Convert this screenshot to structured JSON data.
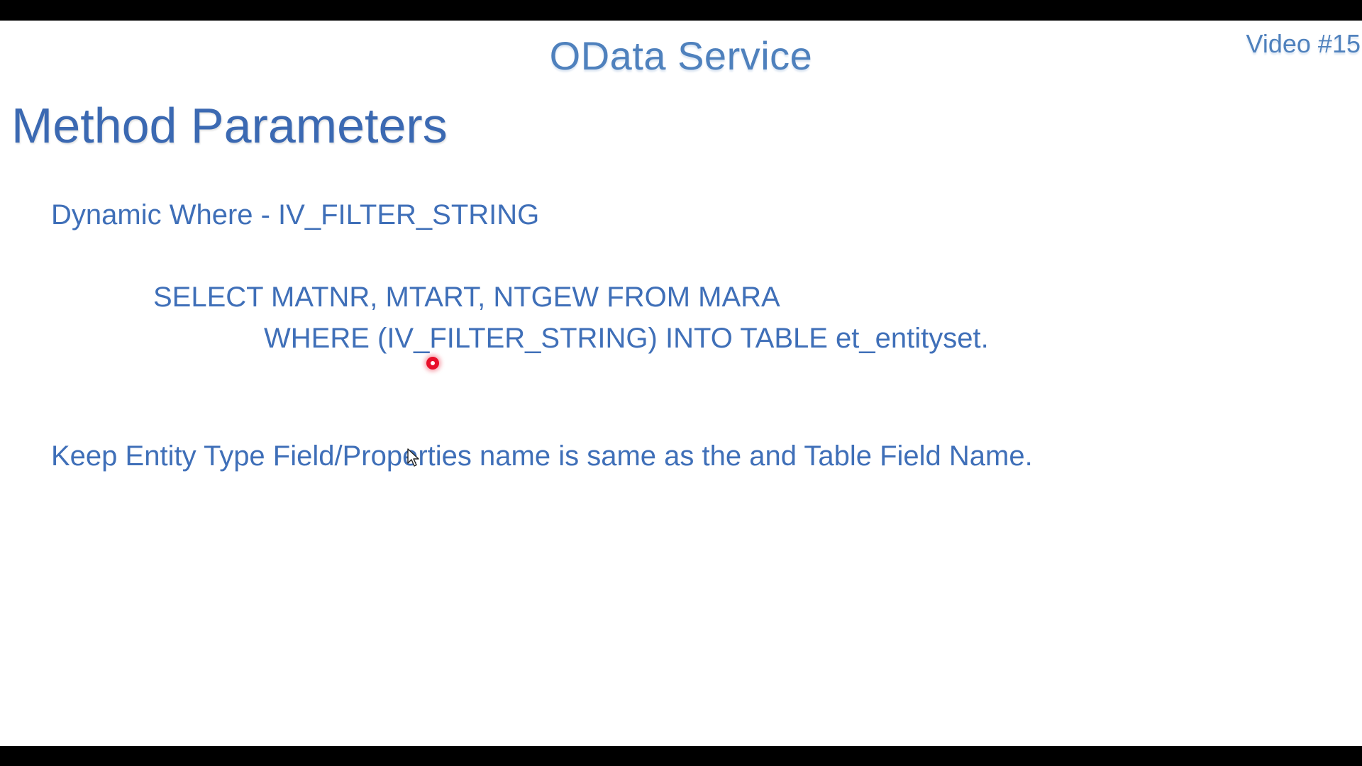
{
  "slide": {
    "header_title": "OData Service",
    "video_label": "Video #15",
    "title": "Method Parameters",
    "lines": [
      "Dynamic Where - IV_FILTER_STRING",
      "SELECT MATNR, MTART, NTGEW FROM MARA",
      "WHERE (IV_FILTER_STRING) INTO TABLE et_entityset.",
      "Keep Entity Type Field/Properties name is same as the and Table Field Name."
    ]
  },
  "colors": {
    "accent": "#4f81bd",
    "title": "#3b69b2",
    "body_text": "#3f6fb8",
    "laser": "#e8102a",
    "letterbox": "#000000"
  },
  "icons": {
    "pointer": "laser-pointer-icon",
    "cursor": "mouse-cursor-icon"
  }
}
